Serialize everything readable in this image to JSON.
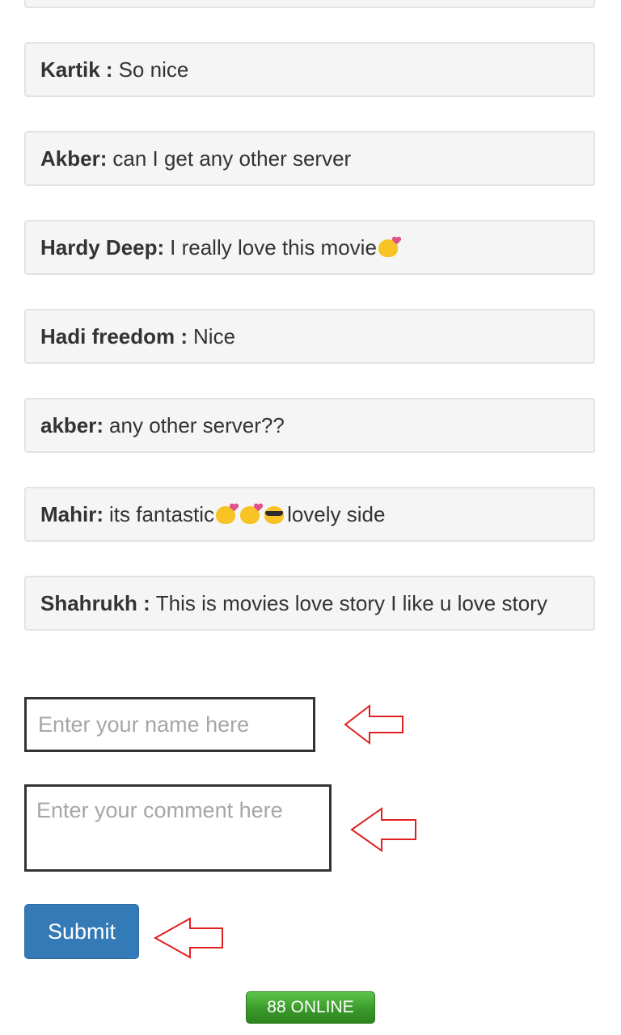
{
  "comments": [
    {
      "author": "Kartik :",
      "text": "So nice"
    },
    {
      "author": "Akber:",
      "text": "can I get any other server"
    },
    {
      "author": "Hardy Deep:",
      "text": "I really love this movie"
    },
    {
      "author": "Hadi freedom :",
      "text": "Nice"
    },
    {
      "author": "akber:",
      "text": "any other server??"
    },
    {
      "author": "Mahir:",
      "text": "its fantastic",
      "text_after": "lovely side"
    },
    {
      "author": "Shahrukh :",
      "text": "This is movies love story I like u love story"
    }
  ],
  "form": {
    "name_placeholder": "Enter your name here",
    "comment_placeholder": "Enter your comment here",
    "submit_label": "Submit"
  },
  "online_badge": "88 ONLINE",
  "icons": {
    "kiss_emoji": "face-blowing-kiss-icon",
    "cool_emoji": "smiling-face-with-sunglasses-icon",
    "annotation_arrow": "red-outline-left-arrow-icon"
  },
  "colors": {
    "submit_button": "#337ab7",
    "online_badge": "#3a9a2a",
    "annotation_arrow": "#e02020",
    "comment_background": "#f5f5f5"
  }
}
